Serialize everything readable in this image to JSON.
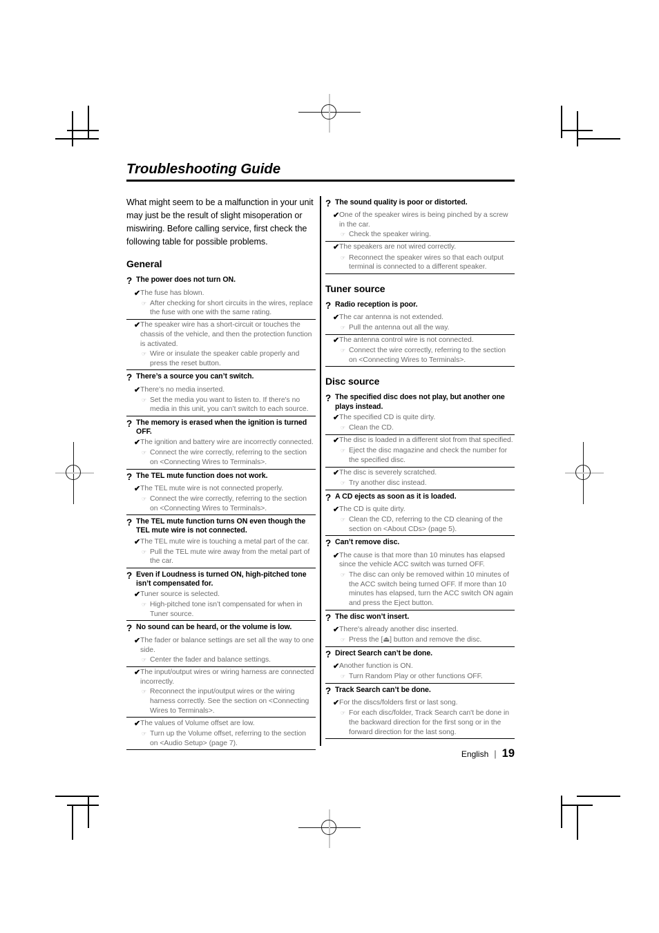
{
  "document": {
    "title": "Troubleshooting Guide",
    "intro": "What might seem to be a malfunction in your unit may just be the result of slight misoperation or miswiring. Before calling service, first check the following table for possible problems.",
    "question_glyph": "?",
    "cause_glyph": "✔",
    "solution_glyph": "☞"
  },
  "footer": {
    "language": "English",
    "separator": "|",
    "page_number": "19"
  },
  "left_column": {
    "sections": [
      {
        "heading": "General",
        "entries": [
          {
            "question": "The power does not turn ON.",
            "causes": [
              {
                "cause": "The fuse has blown.",
                "solutions": [
                  "After checking for short circuits in the wires, replace the fuse with one with the same rating."
                ]
              },
              {
                "cause": "The speaker wire has a short-circuit or touches the chassis of the vehicle, and then the protection function is activated.",
                "solutions": [
                  "Wire or insulate the speaker cable properly and press the reset button."
                ]
              }
            ]
          },
          {
            "question": "There’s a source you can’t switch.",
            "causes": [
              {
                "cause": "There’s no media inserted.",
                "solutions": [
                  "Set the media you want to listen to. If there's no media in this unit, you can’t switch to each source."
                ]
              }
            ]
          },
          {
            "question": "The memory is erased when the ignition is turned OFF.",
            "causes": [
              {
                "cause": "The ignition and battery wire are incorrectly connected.",
                "solutions": [
                  "Connect the wire correctly, referring to the section on <Connecting Wires to Terminals>."
                ]
              }
            ]
          },
          {
            "question": "The TEL mute function does not work.",
            "causes": [
              {
                "cause": "The TEL mute wire is not connected properly.",
                "solutions": [
                  "Connect the wire correctly, referring to the section on <Connecting Wires to Terminals>."
                ]
              }
            ]
          },
          {
            "question": "The TEL mute function turns ON even though the TEL mute wire is not connected.",
            "causes": [
              {
                "cause": "The TEL mute wire is touching a metal part of the car.",
                "solutions": [
                  "Pull the TEL mute wire away from the metal part of the car."
                ]
              }
            ]
          },
          {
            "question": "Even if Loudness is turned ON, high-pitched tone isn’t compensated for.",
            "causes": [
              {
                "cause": "Tuner source is selected.",
                "solutions": [
                  "High-pitched tone isn’t compensated for when in Tuner source."
                ]
              }
            ]
          },
          {
            "question": "No sound can be heard, or the volume is low.",
            "causes": [
              {
                "cause": "The fader or balance settings are set all the way to one side.",
                "solutions": [
                  "Center the fader and balance settings."
                ]
              },
              {
                "cause": "The input/output wires or wiring harness are connected incorrectly.",
                "solutions": [
                  "Reconnect the input/output wires or the wiring harness correctly. See the section on <Connecting Wires to Terminals>."
                ]
              },
              {
                "cause": "The values of Volume offset are low.",
                "solutions": [
                  "Turn up the Volume offset, referring to the section on <Audio Setup> (page 7)."
                ]
              }
            ]
          }
        ]
      }
    ]
  },
  "right_column": {
    "sections": [
      {
        "heading": "",
        "entries": [
          {
            "question": "The sound quality is poor or distorted.",
            "causes": [
              {
                "cause": "One of the speaker wires is being pinched by a screw in the car.",
                "solutions": [
                  "Check the speaker wiring."
                ]
              },
              {
                "cause": "The speakers are not wired correctly.",
                "solutions": [
                  "Reconnect the speaker wires so that each output terminal is connected to a different speaker."
                ]
              }
            ]
          }
        ]
      },
      {
        "heading": "Tuner source",
        "entries": [
          {
            "question": "Radio reception is poor.",
            "causes": [
              {
                "cause": "The car antenna is not extended.",
                "solutions": [
                  "Pull the antenna out all the way."
                ]
              },
              {
                "cause": "The antenna control wire is not connected.",
                "solutions": [
                  "Connect the wire correctly, referring to the section on <Connecting Wires to Terminals>."
                ]
              }
            ]
          }
        ]
      },
      {
        "heading": "Disc source",
        "entries": [
          {
            "question": "The specified disc does not play, but another one plays instead.",
            "causes": [
              {
                "cause": "The specified CD is quite dirty.",
                "solutions": [
                  "Clean the CD."
                ]
              },
              {
                "cause": "The disc is loaded in a different slot from that specified.",
                "solutions": [
                  "Eject the disc magazine and check the number for the specified disc."
                ]
              },
              {
                "cause": "The disc is severely scratched.",
                "solutions": [
                  "Try another disc instead."
                ]
              }
            ]
          },
          {
            "question": "A CD ejects as soon as it is loaded.",
            "causes": [
              {
                "cause": "The CD is quite dirty.",
                "solutions": [
                  "Clean the CD, referring to the CD cleaning of the section on <About CDs> (page 5)."
                ]
              }
            ]
          },
          {
            "question": "Can’t remove disc.",
            "causes": [
              {
                "cause": "The cause is that more than 10 minutes has elapsed since the vehicle ACC switch was turned OFF.",
                "solutions": [
                  "The disc can only be removed within 10 minutes of the ACC switch being turned OFF. If more than 10 minutes has elapsed, turn the ACC switch ON again and press the Eject button."
                ]
              }
            ]
          },
          {
            "question": "The disc won’t insert.",
            "causes": [
              {
                "cause": "There's already another disc inserted.",
                "solutions": [
                  "Press the [⏏] button and remove the disc."
                ]
              }
            ]
          },
          {
            "question": "Direct Search can’t be done.",
            "causes": [
              {
                "cause": "Another function is ON.",
                "solutions": [
                  "Turn Random Play or other functions OFF."
                ]
              }
            ]
          },
          {
            "question": "Track Search can’t be done.",
            "causes": [
              {
                "cause": "For the discs/folders first or last song.",
                "solutions": [
                  "For each disc/folder, Track Search can't be done in the backward direction for the first song or in the forward direction for the last song."
                ]
              }
            ]
          }
        ]
      }
    ]
  }
}
